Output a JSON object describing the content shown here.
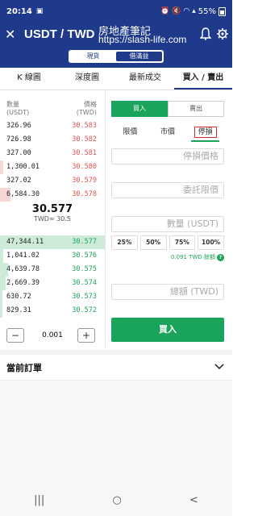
{
  "status": {
    "time": "20:14",
    "battery": "55%"
  },
  "header": {
    "title": "USDT / TWD",
    "watermark_line1": "房地產筆記",
    "watermark_line2": "https://slash-life.com",
    "segments": [
      "現貨",
      "借滿益"
    ],
    "active_segment": 1
  },
  "tabs": [
    "K 線圖",
    "深度圖",
    "最新成交",
    "買入 / 賣出"
  ],
  "book": {
    "col_amount": [
      "數量",
      "(USDT)"
    ],
    "col_price": [
      "價格",
      "(TWD)"
    ],
    "asks": [
      {
        "amount": "326.96",
        "price": "30.583",
        "depth": 0.0
      },
      {
        "amount": "726.98",
        "price": "30.582",
        "depth": 0.0
      },
      {
        "amount": "327.00",
        "price": "30.581",
        "depth": 0.0
      },
      {
        "amount": "1,300.01",
        "price": "30.580",
        "depth": 0.03
      },
      {
        "amount": "327.02",
        "price": "30.579",
        "depth": 0.0
      },
      {
        "amount": "6,584.30",
        "price": "30.578",
        "depth": 0.1
      }
    ],
    "mid_price": "30.577",
    "mid_twd": "TWD≈ 30.5",
    "bids": [
      {
        "amount": "47,344.11",
        "price": "30.577",
        "depth": 1.0
      },
      {
        "amount": "1,041.02",
        "price": "30.576",
        "depth": 0.03
      },
      {
        "amount": "4,639.78",
        "price": "30.575",
        "depth": 0.08
      },
      {
        "amount": "2,669.39",
        "price": "30.574",
        "depth": 0.05
      },
      {
        "amount": "630.72",
        "price": "30.573",
        "depth": 0.02
      },
      {
        "amount": "829.31",
        "price": "30.572",
        "depth": 0.02
      }
    ],
    "step_minus": "−",
    "step_value": "0.001",
    "step_plus": "+"
  },
  "form": {
    "buy_label": "買入",
    "sell_label": "賣出",
    "order_types": [
      "限價",
      "市價",
      "停損"
    ],
    "stop_price_placeholder": "停損價格",
    "limit_price_placeholder": "委託限價",
    "qty_placeholder": "數量 (USDT)",
    "percents": [
      "25%",
      "50%",
      "75%",
      "100%"
    ],
    "available": "0.091 TWD 餘額",
    "total_placeholder": "總額 (TWD)",
    "submit": "買入"
  },
  "orders": {
    "title": "當前訂單"
  },
  "navbar": [
    "|||",
    "○",
    "<"
  ],
  "colors": {
    "brand": "#1f3a8a",
    "buy": "#1aa35a",
    "sell": "#e25050"
  }
}
